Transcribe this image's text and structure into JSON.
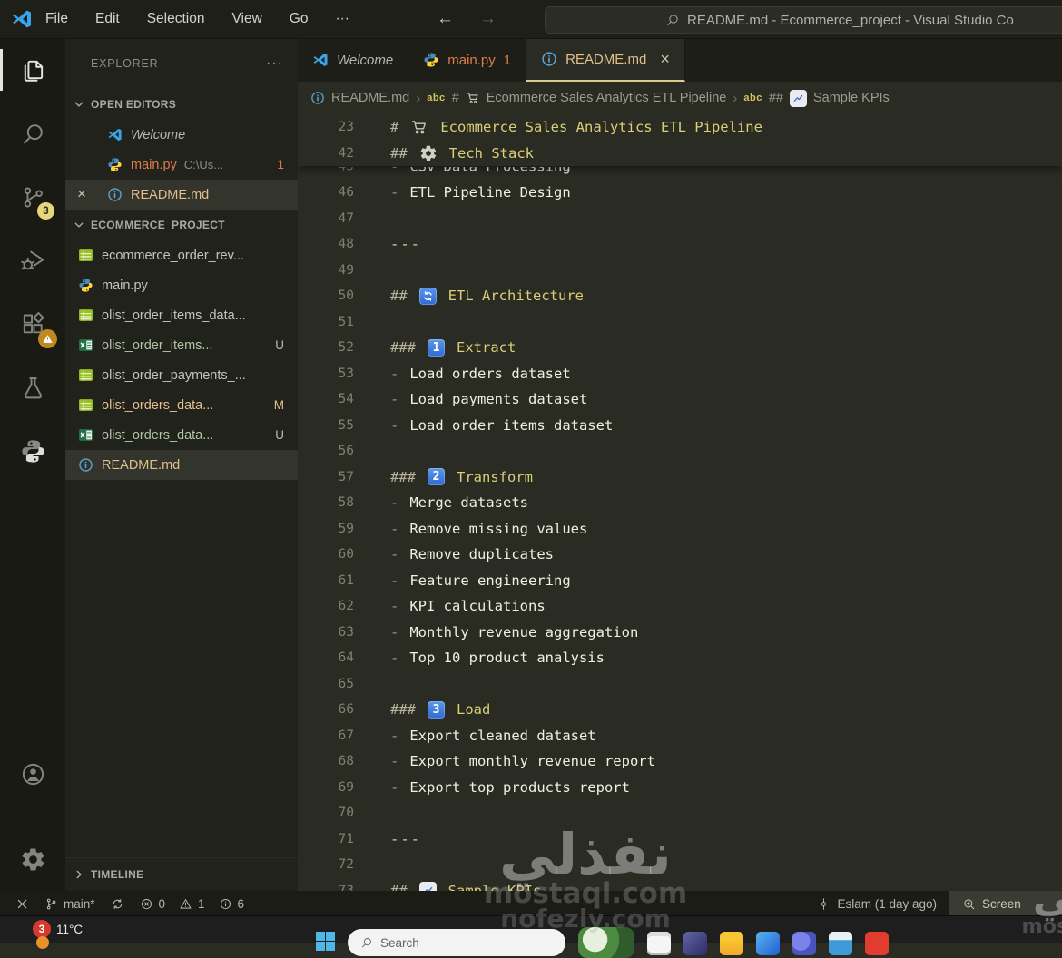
{
  "title_bar": {
    "menus": [
      "File",
      "Edit",
      "Selection",
      "View",
      "Go",
      "···"
    ],
    "window_title": "README.md - Ecommerce_project - Visual Studio Co"
  },
  "activity_bar": {
    "items": [
      {
        "name": "explorer",
        "active": true
      },
      {
        "name": "search"
      },
      {
        "name": "source-control",
        "badge": "3"
      },
      {
        "name": "run-debug"
      },
      {
        "name": "extensions",
        "warning": true
      },
      {
        "name": "testing"
      },
      {
        "name": "python"
      }
    ],
    "bottom_items": [
      {
        "name": "account"
      },
      {
        "name": "settings"
      }
    ]
  },
  "sidebar": {
    "title": "EXPLORER",
    "more_actions": "···",
    "open_editors_header": "OPEN EDITORS",
    "open_editors": [
      {
        "icon": "vscode",
        "label": "Welcome",
        "italic": true
      },
      {
        "icon": "python",
        "label": "main.py",
        "detail": "C:\\Us...",
        "badge": "1",
        "state": "error"
      },
      {
        "icon": "info",
        "label": "README.md",
        "closable": true,
        "state": "modified",
        "active": true
      }
    ],
    "project_header": "ECOMMERCE_PROJECT",
    "files": [
      {
        "icon": "csv",
        "label": "ecommerce_order_rev..."
      },
      {
        "icon": "python",
        "label": "main.py"
      },
      {
        "icon": "csv",
        "label": "olist_order_items_data..."
      },
      {
        "icon": "excel",
        "label": "olist_order_items...",
        "git": "U"
      },
      {
        "icon": "csv",
        "label": "olist_order_payments_..."
      },
      {
        "icon": "csv",
        "label": "olist_orders_data...",
        "git": "M"
      },
      {
        "icon": "excel",
        "label": "olist_orders_data...",
        "git": "U"
      },
      {
        "icon": "info",
        "label": "README.md",
        "state": "modified",
        "selected": true
      }
    ],
    "timeline_header": "TIMELINE"
  },
  "editor": {
    "tabs": [
      {
        "icon": "vscode",
        "label": "Welcome",
        "italic": true
      },
      {
        "icon": "python",
        "label": "main.py",
        "badge": "1",
        "state": "error"
      },
      {
        "icon": "info",
        "label": "README.md",
        "close": "×",
        "state": "modified",
        "active": true
      }
    ],
    "breadcrumb": {
      "file_label": "README.md",
      "segments": [
        {
          "symbol": "abc",
          "hashes": "#",
          "emoji": "cart",
          "label": "Ecommerce Sales Analytics ETL Pipeline"
        },
        {
          "symbol": "abc",
          "hashes": "##",
          "emoji": "chart",
          "label": "Sample KPIs"
        }
      ]
    },
    "sticky_lines": [
      {
        "n": "23",
        "type": "h1",
        "icon": "cart",
        "text": "Ecommerce Sales Analytics ETL Pipeline"
      },
      {
        "n": "42",
        "type": "h2",
        "icon": "gear",
        "text": "Tech Stack"
      }
    ],
    "clipped_line": {
      "n": "45",
      "type": "list",
      "text": "CSV Data Processing"
    },
    "lines": [
      {
        "n": "46",
        "type": "list",
        "text": "ETL Pipeline Design"
      },
      {
        "n": "47",
        "type": "blank"
      },
      {
        "n": "48",
        "type": "hr"
      },
      {
        "n": "49",
        "type": "blank"
      },
      {
        "n": "50",
        "type": "h2",
        "icon": "cycle",
        "text": "ETL Architecture"
      },
      {
        "n": "51",
        "type": "blank"
      },
      {
        "n": "52",
        "type": "h3",
        "icon": "key1",
        "text": "Extract"
      },
      {
        "n": "53",
        "type": "list",
        "text": "Load orders dataset"
      },
      {
        "n": "54",
        "type": "list",
        "text": "Load payments dataset"
      },
      {
        "n": "55",
        "type": "list",
        "text": "Load order items dataset"
      },
      {
        "n": "56",
        "type": "blank"
      },
      {
        "n": "57",
        "type": "h3",
        "icon": "key2",
        "text": "Transform"
      },
      {
        "n": "58",
        "type": "list",
        "text": "Merge datasets"
      },
      {
        "n": "59",
        "type": "list",
        "text": "Remove missing values"
      },
      {
        "n": "60",
        "type": "list",
        "text": "Remove duplicates"
      },
      {
        "n": "61",
        "type": "list",
        "text": "Feature engineering"
      },
      {
        "n": "62",
        "type": "list",
        "text": "KPI calculations"
      },
      {
        "n": "63",
        "type": "list",
        "text": "Monthly revenue aggregation"
      },
      {
        "n": "64",
        "type": "list",
        "text": "Top 10 product analysis"
      },
      {
        "n": "65",
        "type": "blank"
      },
      {
        "n": "66",
        "type": "h3",
        "icon": "key3",
        "text": "Load"
      },
      {
        "n": "67",
        "type": "list",
        "text": "Export cleaned dataset"
      },
      {
        "n": "68",
        "type": "list",
        "text": "Export monthly revenue report"
      },
      {
        "n": "69",
        "type": "list",
        "text": "Export top products report"
      },
      {
        "n": "70",
        "type": "blank"
      },
      {
        "n": "71",
        "type": "hr"
      },
      {
        "n": "72",
        "type": "blank"
      },
      {
        "n": "73",
        "type": "h2",
        "icon": "chart",
        "text": "Sample KPIs"
      }
    ]
  },
  "status_bar": {
    "left": [
      {
        "icon": "remote",
        "name": "remote-indicator"
      },
      {
        "icon": "branch",
        "label": "main*",
        "name": "git-branch"
      },
      {
        "icon": "sync",
        "name": "sync"
      },
      {
        "icon": "error",
        "label": "0",
        "name": "errors"
      },
      {
        "icon": "warning",
        "label": "1",
        "name": "warnings"
      },
      {
        "icon": "info-circle",
        "label": "6",
        "name": "infos"
      }
    ],
    "right": [
      {
        "icon": "commit",
        "label": "Eslam (1 day ago)",
        "name": "git-blame"
      },
      {
        "icon": "zoom-in",
        "label": "Screen",
        "highlight": true,
        "name": "screencast"
      }
    ]
  },
  "taskbar": {
    "weather_badge": "3",
    "weather_temp": "11°C",
    "search_label": "Search",
    "app_icons": [
      "notepad",
      "powerbi",
      "folder",
      "blue-app",
      "people",
      "briefcase",
      "red-app"
    ]
  },
  "watermark": {
    "arabic": "نفذلي",
    "site1": "mostaql.com",
    "site2": "nofezly.com"
  },
  "colors": {
    "heading_yellow": "#d9cf78",
    "git_modified": "#e2c08d",
    "git_untracked": "#b2c3a6",
    "error_orange": "#dd7d49",
    "badge_yellow": "#e6d77b",
    "info_blue": "#58a6d6",
    "editor_bg": "#2a2b23",
    "sidebar_bg": "#21221b",
    "activity_bg": "#191a14"
  }
}
